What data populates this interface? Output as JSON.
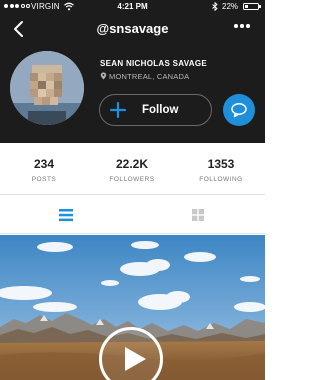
{
  "status_bar": {
    "carrier": "VIRGIN",
    "time": "4:21 PM",
    "battery_percent": "22%",
    "battery_level": 0.22,
    "signal_bars_filled": 3,
    "signal_bars_total": 5
  },
  "nav": {
    "back_icon": "back-chevron-icon",
    "handle": "@snsavage",
    "more_icon": "more-dots-icon"
  },
  "profile": {
    "name": "SEAN NICHOLAS SAVAGE",
    "location": "MONTREAL, CANADA",
    "follow_label": "Follow",
    "message_icon": "chat-bubble-icon",
    "accent_color": "#1e8fd9"
  },
  "stats": [
    {
      "value": "234",
      "label": "POSTS"
    },
    {
      "value": "22.2K",
      "label": "FOLLOWERS"
    },
    {
      "value": "1353",
      "label": "FOLLOWING"
    }
  ],
  "view_tabs": {
    "list_icon": "list-view-icon",
    "grid_icon": "grid-view-icon",
    "active": "list"
  },
  "feed": {
    "media_icon": "play-icon"
  }
}
